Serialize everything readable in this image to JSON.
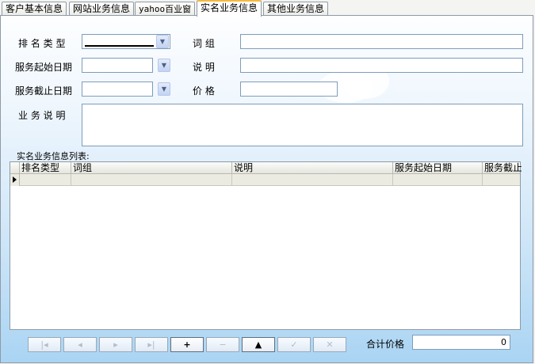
{
  "tabs": [
    {
      "label": "客户基本信息",
      "active": false
    },
    {
      "label": "网站业务信息",
      "active": false
    },
    {
      "label": "yahoo百业窗",
      "active": false
    },
    {
      "label": "实名业务信息",
      "active": true
    },
    {
      "label": "其他业务信息",
      "active": false
    }
  ],
  "form": {
    "ranking_type_label": "排 名 类 型",
    "start_date_label": "服务起始日期",
    "end_date_label": "服务截止日期",
    "business_desc_label": "业 务 说 明",
    "keyword_label": "词    组",
    "note_label": "说    明",
    "price_label": "价    格"
  },
  "grid": {
    "caption": "实名业务信息列表:",
    "columns": [
      "排名类型",
      "词组",
      "说明",
      "服务起始日期",
      "服务截止"
    ]
  },
  "navigator": {
    "buttons": [
      {
        "name": "first",
        "glyph": "|◂"
      },
      {
        "name": "prior",
        "glyph": "◂"
      },
      {
        "name": "next",
        "glyph": "▸"
      },
      {
        "name": "last",
        "glyph": "▸|"
      },
      {
        "name": "insert",
        "glyph": "+"
      },
      {
        "name": "delete",
        "glyph": "−"
      },
      {
        "name": "edit",
        "glyph": "▲"
      },
      {
        "name": "post",
        "glyph": "✓"
      },
      {
        "name": "cancel",
        "glyph": "✕"
      }
    ]
  },
  "total": {
    "label": "合计价格",
    "value": "0"
  },
  "icons": {
    "dropdown": "chevron-down-icon",
    "row_indicator": "triangle-right-icon"
  },
  "colors": {
    "active_tab_accent": "#f6b840",
    "panel_bottom": "#a9d4f3",
    "input_border": "#7f9db9"
  }
}
